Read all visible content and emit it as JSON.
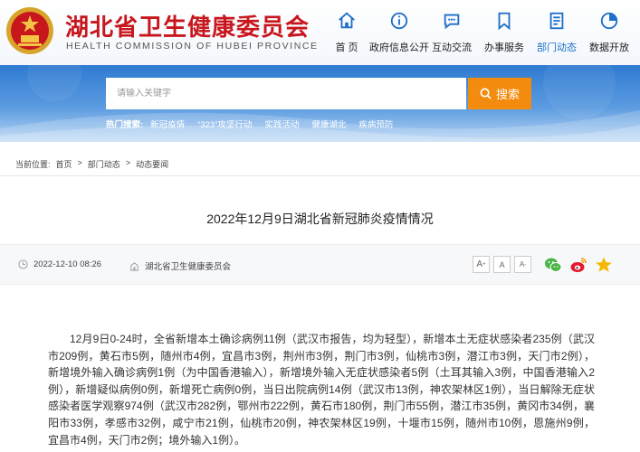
{
  "header": {
    "title": "湖北省卫生健康委员会",
    "subtitle": "HEALTH COMMISSION OF HUBEI PROVINCE",
    "nav": [
      {
        "label": "首 页",
        "icon": "home-icon"
      },
      {
        "label": "政府信息公开",
        "icon": "info-icon"
      },
      {
        "label": "互动交流",
        "icon": "chat-icon"
      },
      {
        "label": "办事服务",
        "icon": "bookmark-icon"
      },
      {
        "label": "部门动态",
        "icon": "document-icon",
        "active": true
      },
      {
        "label": "数据开放",
        "icon": "chart-icon"
      }
    ]
  },
  "search": {
    "placeholder": "请输入关键字",
    "button_label": "搜索",
    "hot_label": "热门搜索:",
    "hot_terms": [
      "新冠疫情",
      "“323”攻坚行动",
      "实践活动",
      "健康湖北",
      "疾病预防"
    ]
  },
  "breadcrumb": {
    "label": "当前位置:",
    "items": [
      "首页",
      "部门动态",
      "动态要闻"
    ],
    "separator": ">"
  },
  "article": {
    "title": "2022年12月9日湖北省新冠肺炎疫情情况",
    "date": "2022-12-10 08:26",
    "source": "湖北省卫生健康委员会",
    "font_sizes": [
      "A",
      "A",
      "A"
    ],
    "share": [
      "wechat-icon",
      "weibo-icon",
      "favorite-icon"
    ],
    "body": "12月9日0-24时，全省新增本土确诊病例11例（武汉市报告，均为轻型），新增本土无症状感染者235例（武汉市209例，黄石市5例，随州市4例，宜昌市3例，荆州市3例，荆门市3例，仙桃市3例，潜江市3例，天门市2例），新增境外输入确诊病例1例（为中国香港输入），新增境外输入无症状感染者5例（土耳其输入3例，中国香港输入2例），新增疑似病例0例，新增死亡病例0例，当日出院病例14例（武汉市13例，神农架林区1例），当日解除无症状感染者医学观察974例（武汉市282例，鄂州市222例，黄石市180例，荆门市55例，潜江市35例，黄冈市34例，襄阳市33例，孝感市32例，咸宁市21例，仙桃市20例，神农架林区19例，十堰市15例，随州市10例，恩施州9例，宜昌市4例，天门市2例；境外输入1例）。"
  },
  "colors": {
    "brand_red": "#c8161d",
    "accent_blue": "#1d6fc7",
    "search_orange": "#f38b0e",
    "banner_blue": "#2f7ad1"
  }
}
